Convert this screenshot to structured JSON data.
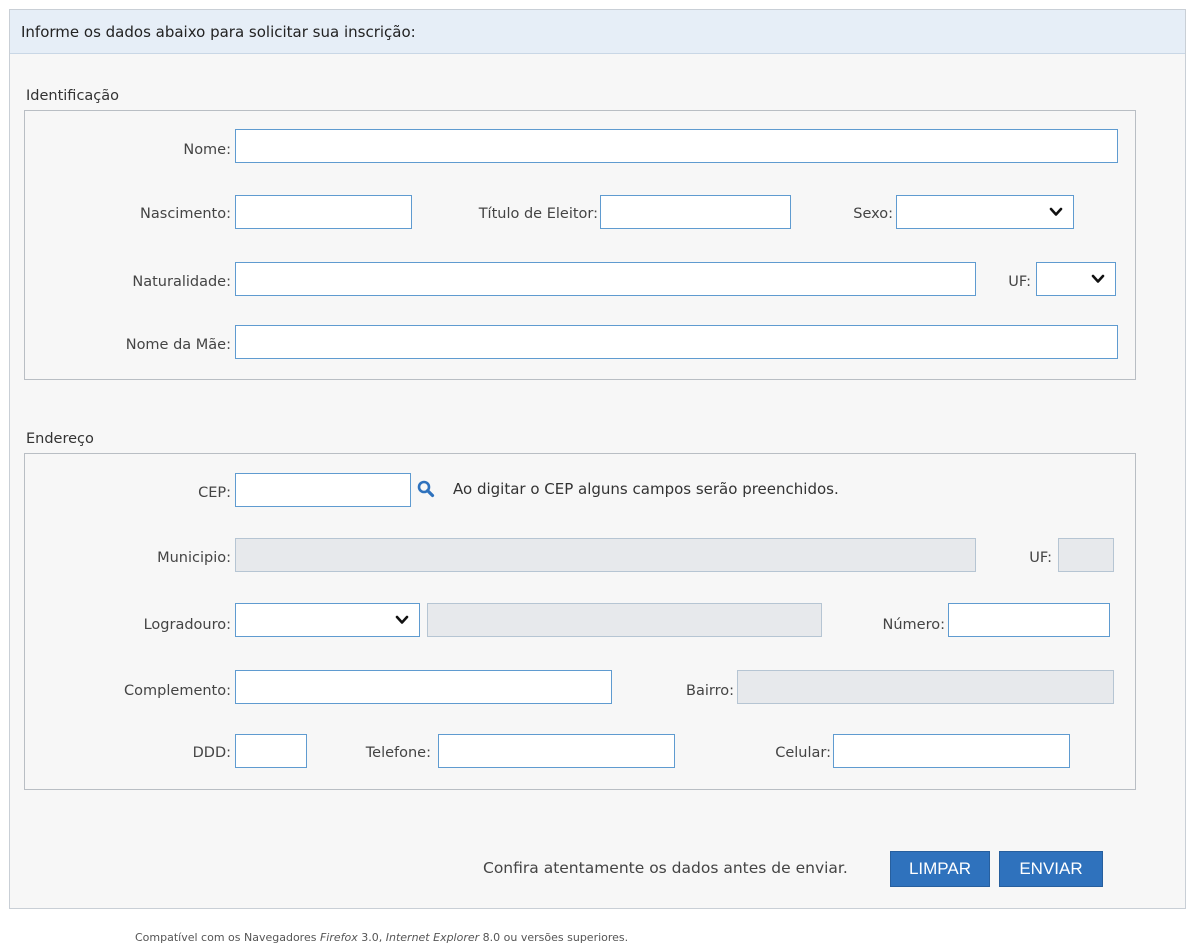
{
  "header": {
    "title": "Informe os dados abaixo para solicitar sua inscrição:"
  },
  "identificacao": {
    "legend": "Identificação",
    "nome_label": "Nome:",
    "nascimento_label": "Nascimento:",
    "titulo_label": "Título de Eleitor:",
    "sexo_label": "Sexo:",
    "naturalidade_label": "Naturalidade:",
    "uf_label": "UF:",
    "mae_label": "Nome da Mãe:",
    "values": {
      "nome": "",
      "nascimento": "",
      "titulo": "",
      "sexo": "",
      "naturalidade": "",
      "uf": "",
      "mae": ""
    }
  },
  "endereco": {
    "legend": "Endereço",
    "cep_label": "CEP:",
    "cep_hint": "Ao digitar o CEP alguns campos serão preenchidos.",
    "municipio_label": "Municipio:",
    "uf_label": "UF:",
    "logradouro_label": "Logradouro:",
    "numero_label": "Número:",
    "complemento_label": "Complemento:",
    "bairro_label": "Bairro:",
    "ddd_label": "DDD:",
    "telefone_label": "Telefone:",
    "celular_label": "Celular:",
    "values": {
      "cep": "",
      "municipio": "",
      "uf": "",
      "logradouro_tipo": "",
      "logradouro": "",
      "numero": "",
      "complemento": "",
      "bairro": "",
      "ddd": "",
      "telefone": "",
      "celular": ""
    }
  },
  "actions": {
    "notice": "Confira atentamente os dados antes de enviar.",
    "clear_label": "LIMPAR",
    "submit_label": "ENVIAR"
  },
  "footer": {
    "prefix": "Compatível com os Navegadores ",
    "browser1": "Firefox",
    "version1": " 3.0, ",
    "browser2": "Internet Explorer",
    "version2": " 8.0 ou versões superiores."
  },
  "icons": {
    "search": "search-icon",
    "dropdown": "chevron-down-icon"
  },
  "colors": {
    "button_bg": "#2f72bd",
    "input_border": "#5f9bd0",
    "header_bg": "#e6eef7",
    "readonly_bg": "#e7e9ec"
  }
}
